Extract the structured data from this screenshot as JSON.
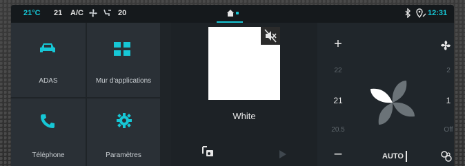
{
  "status": {
    "temp_left": "21°C",
    "temp_setting": "21",
    "ac_label": "A/C",
    "fan_level": "20",
    "time": "12:31",
    "colors": {
      "accent": "#16c7d6"
    }
  },
  "tiles": [
    {
      "label": "ADAS",
      "icon": "car-icon"
    },
    {
      "label": "Mur d'applications",
      "icon": "apps-grid-icon"
    },
    {
      "label": "Téléphone",
      "icon": "phone-icon"
    },
    {
      "label": "Paramètres",
      "icon": "gear-icon"
    }
  ],
  "media": {
    "track_title": "White",
    "icons": [
      "mute-icon",
      "radio-icon",
      "play-icon"
    ]
  },
  "climate": {
    "plus": "+",
    "minus": "−",
    "temp_upper": "22",
    "temp_current": "21",
    "temp_lower": "20.5",
    "fan_upper": "2",
    "fan_current": "1",
    "fan_off": "Off",
    "auto_label": "AUTO",
    "icons": [
      "fan-icon",
      "recirculation-icon"
    ]
  }
}
